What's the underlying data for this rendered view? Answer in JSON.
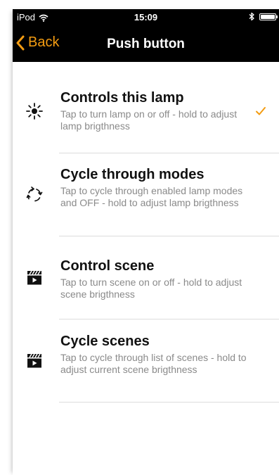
{
  "status_bar": {
    "carrier": "iPod",
    "time": "15:09"
  },
  "nav": {
    "back_label": "Back",
    "title": "Push button"
  },
  "options": [
    {
      "title": "Controls this lamp",
      "description": "Tap to turn lamp on or off - hold to adjust lamp brigthness",
      "icon": "sun-icon",
      "selected": true
    },
    {
      "title": "Cycle through modes",
      "description": "Tap to cycle through enabled lamp modes and OFF - hold to adjust lamp brigthness",
      "icon": "cycle-icon",
      "selected": false
    },
    {
      "title": "Control scene",
      "description": "Tap to turn scene on or off - hold to adjust scene brigthness",
      "icon": "clapperboard-icon",
      "selected": false
    },
    {
      "title": "Cycle scenes",
      "description": "Tap to cycle through list of scenes - hold to adjust current scene brigthness",
      "icon": "clapperboard-icon",
      "selected": false
    }
  ],
  "colors": {
    "accent": "#f39c12",
    "nav_background": "#000000",
    "title_text": "#111111",
    "description_text": "#8a8a8a",
    "divider": "#dcdcdc"
  }
}
